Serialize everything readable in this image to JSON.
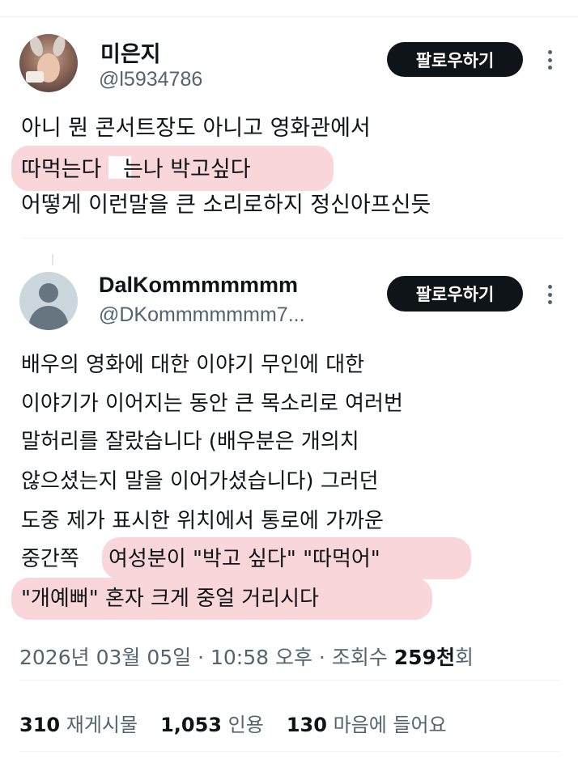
{
  "tweet": {
    "author": {
      "name": "미은지",
      "handle": "@l5934786"
    },
    "follow_label": "팔로우하기",
    "lines": [
      "아니 뭔 콘서트장도 아니고 영화관에서",
      "따먹는다 ",
      "는나 박고싶다",
      "어떻게 이런말을 큰 소리로하지 정신아프신듯"
    ]
  },
  "reply": {
    "author": {
      "name": "DalKommmmmmm",
      "handle": "@DKommmmmmm7..."
    },
    "follow_label": "팔로우하기",
    "lines": [
      "배우의 영화에 대한 이야기 무인에 대한",
      "이야기가 이어지는 동안 큰 목소리로 여러번",
      "말허리를 잘랐습니다 (배우분은 개의치",
      "않으셨는지 말을 이어가셨습니다) 그러던",
      "도중 제가 표시한 위치에서 통로에 가까운"
    ],
    "line6_plain": "중간쪽 ",
    "line6_highlight": "여성분이 \"박고 싶다\" \"따먹어\"",
    "line7_highlight": "\"개예뻐\" 혼자 크게 중얼 거리시다"
  },
  "meta": {
    "datetime": "2026년 03월 05일 · 10:58 오후 · 조회수 ",
    "views_number": "259천",
    "views_unit": "회"
  },
  "stats": {
    "reposts_count": "310",
    "reposts_label": "재게시물",
    "quotes_count": "1,053",
    "quotes_label": "인용",
    "likes_count": "130",
    "likes_label": "마음에 들어요"
  },
  "colors": {
    "highlight": "#f9d6da",
    "button_bg": "#0f1419",
    "secondary_text": "#536471"
  }
}
